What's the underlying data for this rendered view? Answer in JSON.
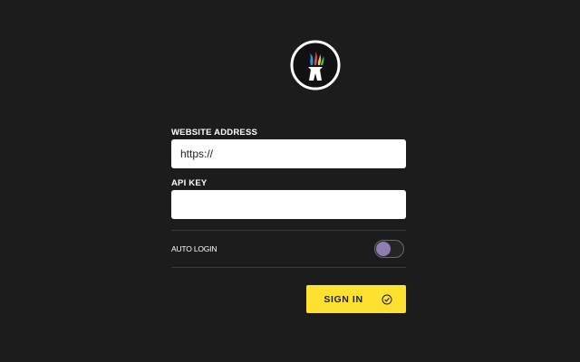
{
  "colors": {
    "background": "#1c1c1c",
    "accent": "#ffe230",
    "toggle_knob": "#8e7fb0",
    "input_bg": "#ffffff"
  },
  "logo": {
    "icon": "flame-brand-logo-icon"
  },
  "form": {
    "website_label": "WEBSITE ADDRESS",
    "website_value": "https://",
    "website_placeholder": "",
    "api_key_label": "API KEY",
    "api_key_value": "",
    "auto_login_label": "AUTO LOGIN",
    "auto_login_enabled": false
  },
  "actions": {
    "sign_in_label": "SIGN IN",
    "sign_in_icon": "check-circle-icon"
  }
}
